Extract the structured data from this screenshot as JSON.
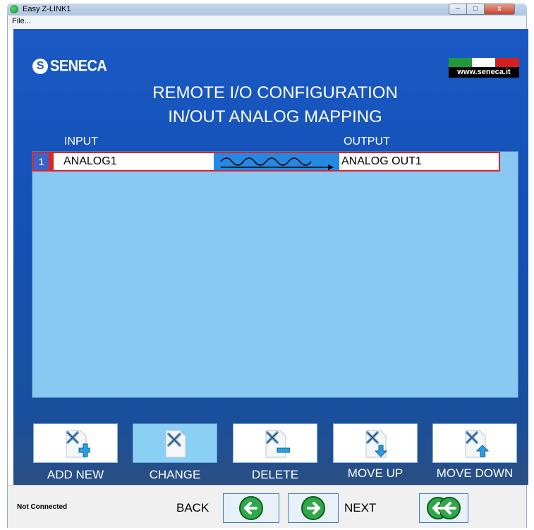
{
  "window": {
    "title": "Easy Z-LINK1",
    "min": "–",
    "max": "□",
    "close": "x"
  },
  "menu": {
    "file": "File..."
  },
  "brand": {
    "logo_text": "SENECA",
    "logo_mark": "S",
    "site_text": "www.seneca.it"
  },
  "header": {
    "title_line1": "REMOTE I/O CONFIGURATION",
    "title_line2": "IN/OUT ANALOG MAPPING"
  },
  "columns": {
    "input": "INPUT",
    "output": "OUTPUT"
  },
  "mappings": [
    {
      "index": "1",
      "input": "ANALOG1",
      "output": "ANALOG OUT1"
    }
  ],
  "actions": [
    {
      "label": "ADD NEW",
      "icon": "tools-add-icon"
    },
    {
      "label": "CHANGE",
      "icon": "tools-edit-icon"
    },
    {
      "label": "DELETE",
      "icon": "tools-remove-icon"
    },
    {
      "label": "MOVE UP",
      "icon": "tools-move-down-icon"
    },
    {
      "label": "MOVE DOWN",
      "icon": "tools-move-up-icon"
    }
  ],
  "footer": {
    "status": "Not Connected",
    "back": "BACK",
    "next": "NEXT"
  },
  "colors": {
    "panel": "#1351b5",
    "list": "#88c8f3",
    "row_border": "#d8222a",
    "wave_bg": "#2489e3",
    "nav_green": "#2fa84a"
  }
}
